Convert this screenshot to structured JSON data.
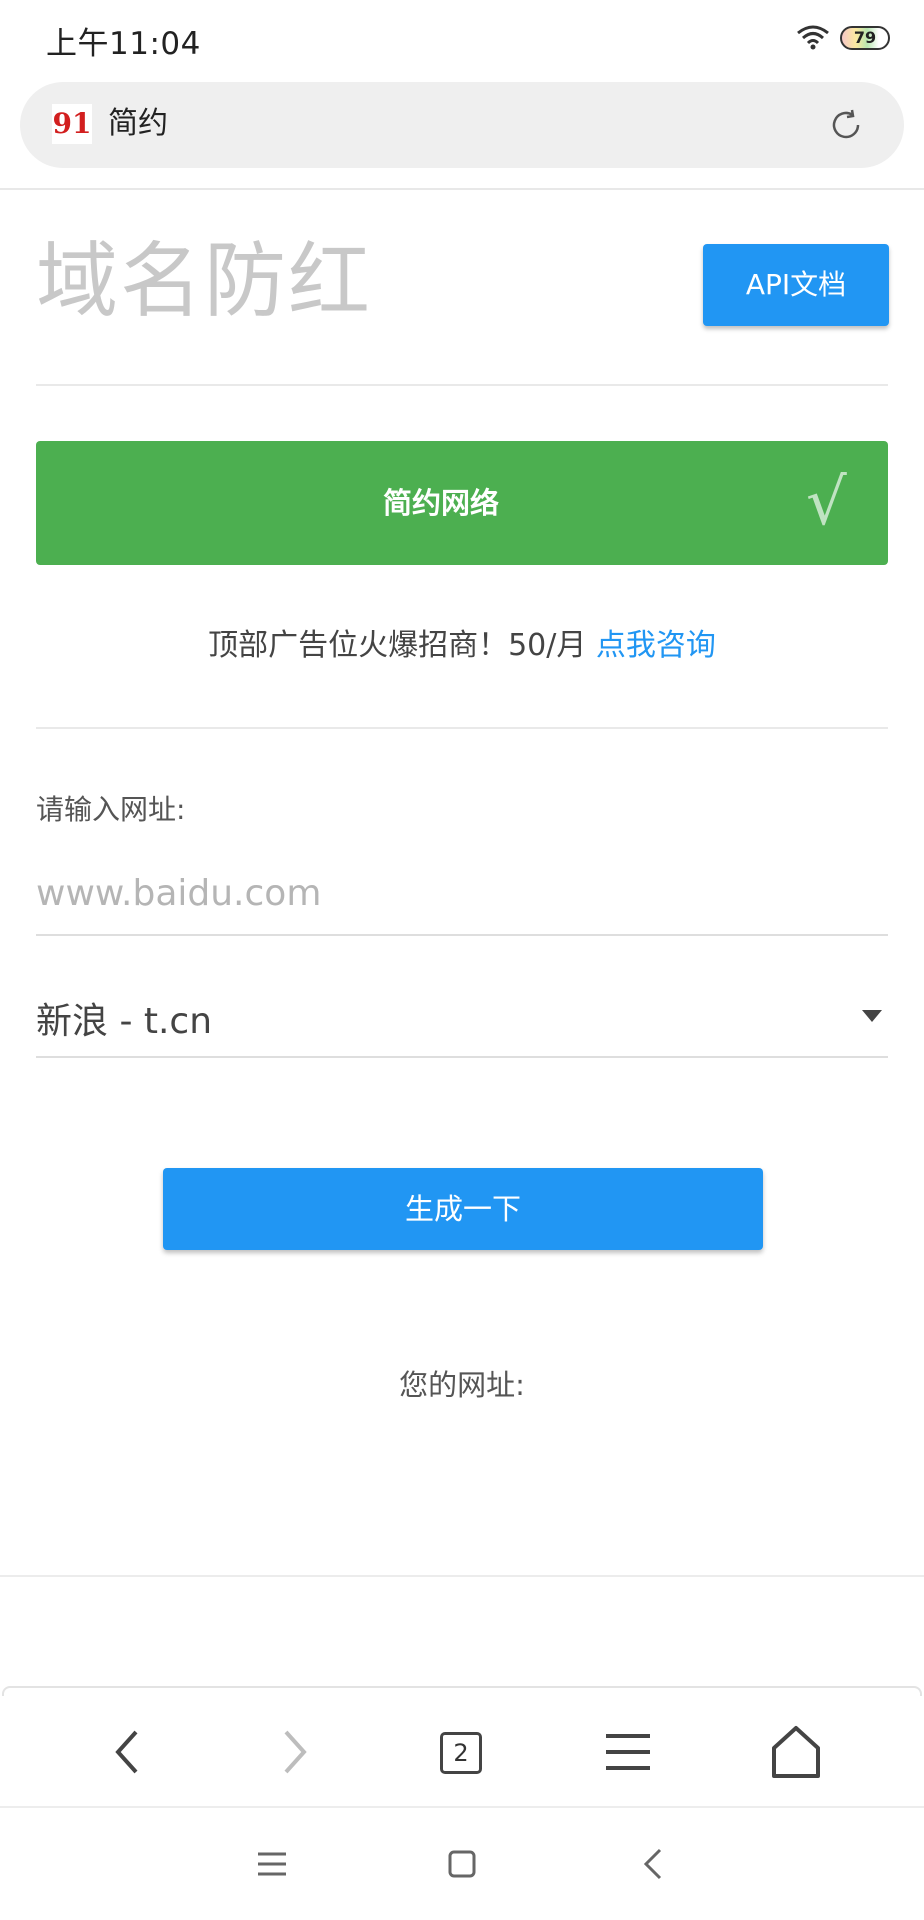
{
  "status_bar": {
    "time": "上午11:04",
    "battery": "79"
  },
  "address_bar": {
    "logo_text": "91",
    "title": "简约"
  },
  "header": {
    "title": "域名防红",
    "api_button": "API文档"
  },
  "banner": {
    "label": "简约网络",
    "check": "√"
  },
  "ad": {
    "text": "顶部广告位火爆招商！50/月 ",
    "link": "点我咨询"
  },
  "form": {
    "url_label": "请输入网址:",
    "url_placeholder": "www.baidu.com",
    "url_value": "",
    "service_selected": "新浪 - t.cn",
    "generate_button": "生成一下",
    "result_label": "您的网址:"
  },
  "toolbar": {
    "tab_count": "2"
  },
  "colors": {
    "primary": "#2196f3",
    "success": "#4caf50",
    "title_gray": "#c8c8c8"
  }
}
